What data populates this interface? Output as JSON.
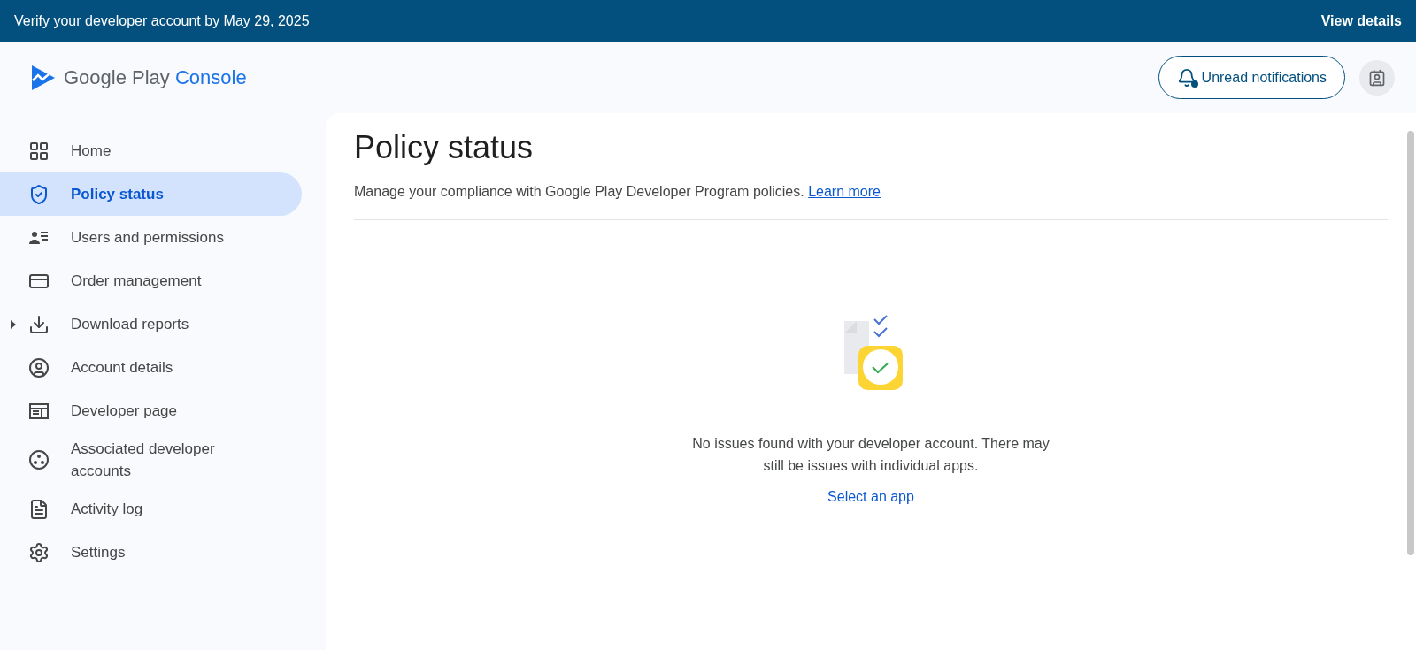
{
  "banner": {
    "message": "Verify your developer account by May 29, 2025",
    "action": "View details"
  },
  "header": {
    "logo": {
      "brand": "Google Play",
      "product": "Console"
    },
    "notifications_button": "Unread notifications",
    "has_unread": true
  },
  "sidebar": {
    "items": [
      {
        "label": "Home",
        "selected": false
      },
      {
        "label": "Policy status",
        "selected": true
      },
      {
        "label": "Users and permissions",
        "selected": false
      },
      {
        "label": "Order management",
        "selected": false
      },
      {
        "label": "Download reports",
        "selected": false,
        "expanded": false
      },
      {
        "label": "Account details",
        "selected": false
      },
      {
        "label": "Developer page",
        "selected": false
      },
      {
        "label": "Associated developer accounts",
        "selected": false
      },
      {
        "label": "Activity log",
        "selected": false
      },
      {
        "label": "Settings",
        "selected": false
      }
    ]
  },
  "page": {
    "title": "Policy status",
    "description": "Manage your compliance with Google Play Developer Program policies.",
    "learn_more": "Learn more",
    "empty_state": {
      "message": "No issues found with your developer account. There may still be issues with individual apps.",
      "action": "Select an app"
    }
  }
}
